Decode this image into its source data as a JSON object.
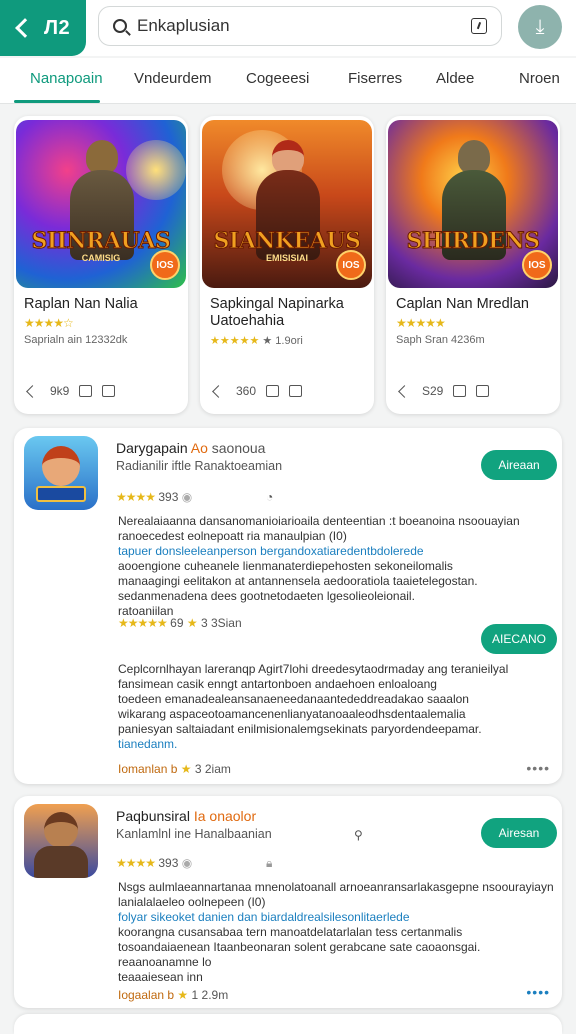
{
  "header": {
    "back_label": "Л2",
    "search_value": "Enkaplusian",
    "search_placeholder": "Search"
  },
  "tabs": [
    "Nanapoain",
    "Vndeurdem",
    "Cogeeesi",
    "Fiserres",
    "Aldee",
    "Nroen"
  ],
  "cards": [
    {
      "art_title": "SIINRAUAS",
      "art_sub": "CAMISIG",
      "badge": "IOS",
      "name": "Raplan Nan Nalia",
      "rating_text": "",
      "meta": "Saprialn ain  12332dk",
      "action_count": "9k9"
    },
    {
      "art_title": "SIANKEAUS",
      "art_sub": "EMISISIAI",
      "badge": "IOS",
      "name": "Sapkingal Napinarka Uatoehahia",
      "rating_text": "★ 1.9ori",
      "meta": "",
      "action_count": "360"
    },
    {
      "art_title": "SHIRDENS",
      "art_sub": "",
      "badge": "IOS",
      "name": "Caplan Nan Mredlan",
      "rating_text": "",
      "meta": "Saph Sran  4236m",
      "action_count": "S29"
    }
  ],
  "reviews": [
    {
      "app_name": "Darygapain",
      "app_hl": "Ao",
      "app_suffix": "saonoua",
      "dev": "Radianilir iftle  Ranaktoeamian",
      "button": "Aireaan",
      "rating": "393",
      "lines": [
        {
          "t": "Nerealaiaanna  dansanomanioiarioaila  denteentian  :t  boeanoina nsoouayian",
          "c": ""
        },
        {
          "t": "ranoecedest  eolnepoatt  ria      manaulpian                               (I0)",
          "c": ""
        },
        {
          "t": "tapuer donsleeleanperson  bergandoxatiaredentbdolerede",
          "c": "blue"
        },
        {
          "t": "aooengione  cuheanele lienmanaterdiepehosten sekoneilomalis",
          "c": ""
        },
        {
          "t": "manaagingi eelitakon at  antannensela aedooratiola taaietelegostan.",
          "c": ""
        },
        {
          "t": "sedanmenadena dees gootnetodaeten lgesolieoleionail.",
          "c": ""
        },
        {
          "t": "ratoaniilan",
          "c": ""
        }
      ],
      "reply_rating": "69",
      "reply_date": "3 3Sian",
      "reply_button": "AIECANO",
      "reply_lines": [
        {
          "t": "Ceplcornlhayan lareranqp Agirt7lohi dreedesytaodrmaday ang teranieilyal",
          "c": "blue"
        },
        {
          "t": "fansimean  casik enngt antartonboen andaehoen  enloaloang",
          "c": ""
        },
        {
          "t": "toedeen  emanadealeansanaeneedanaantededdreadakao  saaalon",
          "c": ""
        },
        {
          "t": "wikarang aspaceotoamancenenlianyatanoaaleodhsdentaalemalia",
          "c": ""
        },
        {
          "t": "paniesyan saltaiadant  enilmisionalemgsekinats  paryordendeepamar.",
          "c": ""
        },
        {
          "t": "tianedanm.",
          "c": "blue"
        }
      ],
      "footer_left": "Iomanlan",
      "footer_b": "b",
      "footer_date": "3 2iam"
    },
    {
      "app_name": "Paqbunsiral",
      "app_hl": "Ia",
      "app_suffix": "onaolor",
      "dev": "Kanlamlnl ine  Hanalbaanian",
      "button": "Airesan",
      "rating": "393",
      "lines": [
        {
          "t": "Nsgs aulmlaeannartanaa  mnenolatoanall  arnoeanransarlakasgepne  nsoourayiayn",
          "c": ""
        },
        {
          "t": "lanialalaeleo  oolnepeen                                                  (I0)",
          "c": ""
        },
        {
          "t": "folyar sikeoket danien dan  biardaldrealsilesonlitaerlede",
          "c": "blue"
        },
        {
          "t": "koorangna  cusansabaa tern manoatdelatarlalan  tess certanmalis",
          "c": ""
        },
        {
          "t": "tosoandaiaenean Itaanbeonaran solent gerabcane  sate caoaonsgai.",
          "c": ""
        },
        {
          "t": "reaanoanamne          lo",
          "c": ""
        },
        {
          "t": "teaaaiesean    inn",
          "c": ""
        }
      ],
      "footer_left": "Iogaalan",
      "footer_b": "b",
      "footer_date": "1 2.9m"
    }
  ]
}
